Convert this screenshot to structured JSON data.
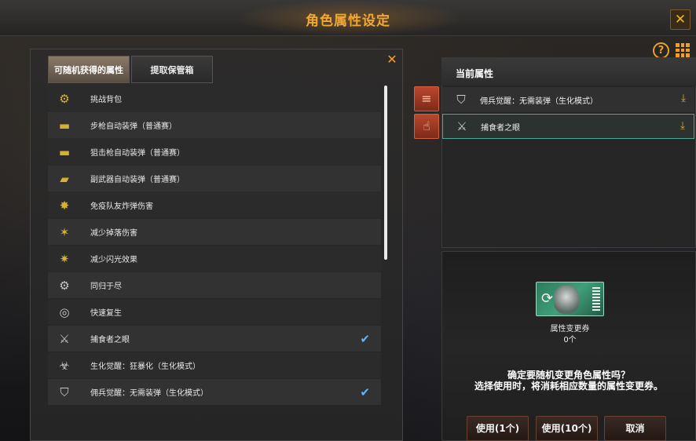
{
  "window": {
    "title": "角色属性设定",
    "close_icon": "close-icon"
  },
  "left": {
    "tabs": [
      {
        "label": "可随机获得的属性",
        "active": true
      },
      {
        "label": "提取保管箱",
        "active": false
      }
    ],
    "items": [
      {
        "label": "挑战背包",
        "icon": "gold-gear-icon",
        "checked": false
      },
      {
        "label": "步枪自动装弹（普通赛）",
        "icon": "rifle-icon",
        "checked": false
      },
      {
        "label": "狙击枪自动装弹（普通赛）",
        "icon": "sniper-icon",
        "checked": false
      },
      {
        "label": "副武器自动装弹（普通赛）",
        "icon": "pistol-icon",
        "checked": false
      },
      {
        "label": "免疫队友炸弹伤害",
        "icon": "explosion-icon",
        "checked": false
      },
      {
        "label": "减少掉落伤害",
        "icon": "fall-icon",
        "checked": false
      },
      {
        "label": "减少闪光效果",
        "icon": "flash-icon",
        "checked": false
      },
      {
        "label": "同归于尽",
        "icon": "mine-icon",
        "checked": false
      },
      {
        "label": "快速复生",
        "icon": "revive-icon",
        "checked": false
      },
      {
        "label": "捕食者之眼",
        "icon": "claw-icon",
        "checked": true
      },
      {
        "label": "生化觉醒：狂暴化（生化模式）",
        "icon": "mutant-icon",
        "checked": false
      },
      {
        "label": "佣兵觉醒：无需装弹（生化模式）",
        "icon": "shield-icon",
        "checked": true
      }
    ]
  },
  "right": {
    "title": "当前属性",
    "current": [
      {
        "label": "佣兵觉醒：无需装弹（生化模式）",
        "icon": "shield-icon"
      },
      {
        "label": "捕食者之眼",
        "icon": "claw-icon"
      }
    ]
  },
  "voucher": {
    "name": "属性变更券",
    "count": "0个"
  },
  "confirm": {
    "line1": "确定要随机变更角色属性吗？",
    "line2": "选择使用时，将消耗相应数量的属性变更券。"
  },
  "buttons": {
    "use1": "使用(1个)",
    "use10": "使用(10个)",
    "cancel": "取消"
  },
  "colors": {
    "accent": "#f0a830",
    "check": "#5cb6ff",
    "selected_border": "#4aa894"
  }
}
